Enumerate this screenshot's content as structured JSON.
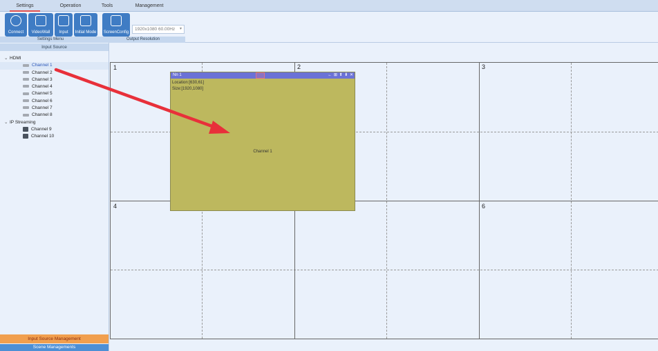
{
  "menu": {
    "items": [
      {
        "label": "Settings",
        "active": true
      },
      {
        "label": "Operation",
        "active": false
      },
      {
        "label": "Tools",
        "active": false
      },
      {
        "label": "Management",
        "active": false
      }
    ]
  },
  "ribbon": {
    "buttons": [
      {
        "label": "Connect",
        "icon": "connect-icon"
      },
      {
        "label": "VideoWall",
        "icon": "videowall-icon"
      },
      {
        "label": "Input",
        "icon": "input-icon"
      },
      {
        "label": "Initial Mode",
        "icon": "grid-icon"
      },
      {
        "label": "ScreenConfig",
        "icon": "screenconfig-icon"
      }
    ],
    "settings_group_label": "Settings Menu",
    "output_group_label": "Output Resolution",
    "resolution_value": "1920x1080 60.00Hz"
  },
  "sidebar": {
    "header": "Input Source",
    "groups": [
      {
        "label": "HDMI",
        "expanded": true,
        "items": [
          "Channel 1",
          "Channel 2",
          "Channel 3",
          "Channel 4",
          "Channel 5",
          "Channel 6",
          "Channel 7",
          "Channel 8"
        ]
      },
      {
        "label": "IP Streaming",
        "expanded": true,
        "items": [
          "Channel 9",
          "Channel 10"
        ]
      }
    ],
    "selected_item": "Channel 1",
    "tab_input": "Input Source Management",
    "tab_scene": "Scene Managements"
  },
  "wall": {
    "screen_labels": [
      "1",
      "2",
      "3",
      "4",
      "6"
    ]
  },
  "window": {
    "title": "Nn 1",
    "location": "Location:[630,61]",
    "size": "Size:[1920,1080]",
    "content": "Channel 1",
    "controls": [
      "←",
      "⊞",
      "⬆",
      "⬇",
      "✕"
    ]
  },
  "colors": {
    "accent": "#3f7cc4",
    "window_fill": "#bdb85e",
    "window_title": "#6b72d6",
    "arrow": "#e8303a",
    "input_tab": "#f19f4e",
    "scene_tab": "#4d8fd5"
  }
}
